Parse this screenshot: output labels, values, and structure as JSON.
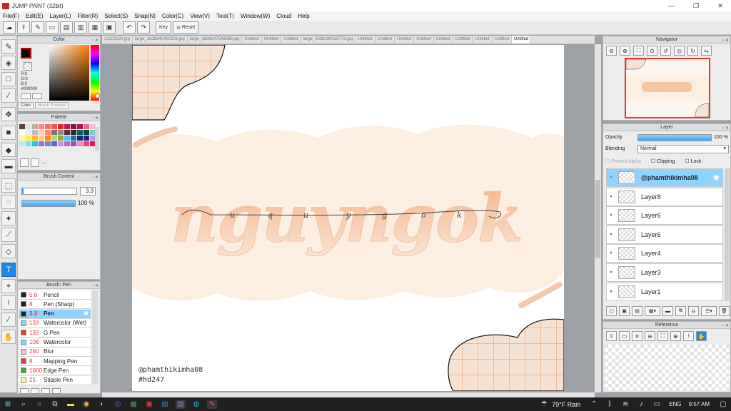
{
  "titlebar": {
    "title": "JUMP PAINT (32bit)",
    "min": "—",
    "max": "❐",
    "close": "✕"
  },
  "menu": [
    "File(F)",
    "Edit(E)",
    "Layer(L)",
    "Filter(R)",
    "Select(S)",
    "Snap(N)",
    "Color(C)",
    "View(V)",
    "Tool(T)",
    "Window(W)",
    "Cloud",
    "Help"
  ],
  "toolbar": {
    "key_label": "Key",
    "reset_label": "Reset"
  },
  "panels": {
    "color": {
      "title": "Color",
      "r": "R:0",
      "g": "G:0",
      "b": "B:0",
      "hex": "#000000",
      "tab_color": "Color",
      "tab_brush_preview": "Brush Preview"
    },
    "palette": {
      "title": "Palette",
      "more": "···",
      "colors": [
        "#5d4037",
        "#e0e0e0",
        "#bcaaa4",
        "#ff8a80",
        "#e57373",
        "#ef5350",
        "#d32f2f",
        "#c2185b",
        "#880e4f",
        "#ad1457",
        "#f06292",
        "#f8bbd0",
        "#ffffff",
        "#eeeeee",
        "#bdbdbd",
        "#ffccbc",
        "#ff8a65",
        "#8d6e63",
        "#a1887f",
        "#4e342e",
        "#3e2723",
        "#00695c",
        "#004d40",
        "#80cbc4",
        "#fff59d",
        "#ffee58",
        "#fbc02d",
        "#ffcc80",
        "#fb8c00",
        "#aed581",
        "#7cb342",
        "#4fc3f7",
        "#0277bd",
        "#1a237e",
        "#311b92",
        "#b39ddb",
        "#b2ebf2",
        "#80deea",
        "#26c6da",
        "#9575cd",
        "#7986cb",
        "#5c6bc0",
        "#ce93d8",
        "#ba68c8",
        "#ab47bc",
        "#f48fb1",
        "#ec407a",
        "#d81b60"
      ]
    },
    "brush_control": {
      "title": "Brush Control",
      "size": "3.3",
      "opacity": "100 %"
    },
    "brush": {
      "title": "Brush: Pen",
      "items": [
        {
          "size": "5.6",
          "name": "Pencil",
          "color": "#222222"
        },
        {
          "size": "8",
          "name": "Pen (Sharp)",
          "color": "#222222"
        },
        {
          "size": "3.3",
          "name": "Pen",
          "color": "#222222"
        },
        {
          "size": "133",
          "name": "Watercolor (Wet)",
          "color": "#81d4fa"
        },
        {
          "size": "133",
          "name": "G Pen",
          "color": "#e53935"
        },
        {
          "size": "106",
          "name": "Watercolor",
          "color": "#81d4fa"
        },
        {
          "size": "260",
          "name": "Blur",
          "color": "#f8bbd0"
        },
        {
          "size": "8",
          "name": "Mapping Pen",
          "color": "#e53935"
        },
        {
          "size": "1000",
          "name": "Edge Pen",
          "color": "#43a047"
        },
        {
          "size": "25",
          "name": "Stipple Pen",
          "color": "#fff59d"
        }
      ]
    },
    "navigator": {
      "title": "Navigator"
    },
    "layer": {
      "title": "Layer",
      "opacity_label": "Opacity",
      "opacity_value": "100 %",
      "blending_label": "Blending",
      "blending_value": "Normal",
      "protect_alpha": "Protect Alpha",
      "clipping": "Clipping",
      "lock": "Lock",
      "layers": [
        "@phamthikimha08",
        "Layer8",
        "Layer6",
        "Layer6",
        "Layer4",
        "Layer3",
        "Layer1"
      ]
    },
    "reference": {
      "title": "Reference"
    }
  },
  "doc_tabs": [
    "21102530.jpg",
    "large_1638340450633.jpg",
    "large_1638247543589.jpg",
    "Untitled",
    "Untitled",
    "Untitled",
    "large_1638330018773.jpg",
    "Untitled",
    "Untitled",
    "Untitled",
    "Untitled",
    "Untitled",
    "Untitled",
    "Untitled",
    "Untitled",
    "Untitled"
  ],
  "artwork": {
    "title": "nguyngok",
    "script_letters": [
      "u",
      "q",
      "u",
      "y",
      "g",
      "o",
      "k"
    ],
    "credit_handle": "@phamthikimha08",
    "credit_tag": "#hd247",
    "accent": "#f5b98c"
  },
  "taskbar": {
    "weather": "79°F Rain",
    "language": "ENG",
    "time": "9:57 AM"
  }
}
